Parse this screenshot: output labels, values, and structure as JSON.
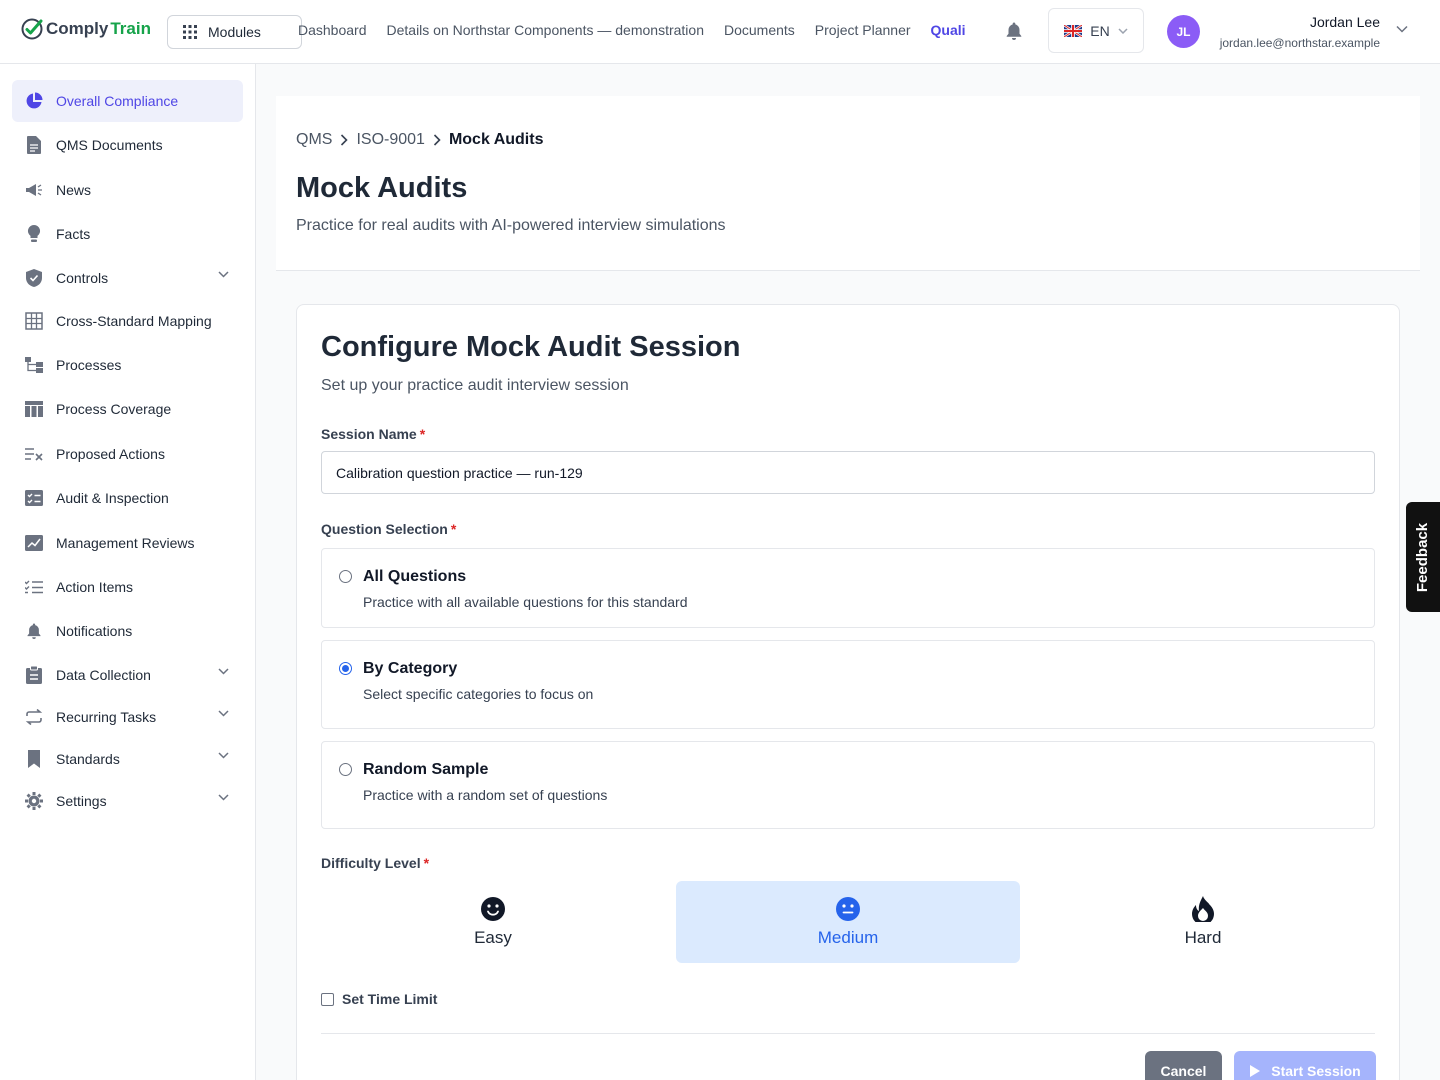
{
  "brand": {
    "comply": "Comply",
    "train": "Train"
  },
  "topbar": {
    "modules_label": "Modules",
    "nav": [
      "Dashboard",
      "Details on Northstar Components — demonstration",
      "Documents",
      "Project Planner",
      "Quali"
    ],
    "language": "EN",
    "user": {
      "initials": "JL",
      "name": "Jordan Lee",
      "email": "jordan.lee@northstar.example"
    }
  },
  "sidebar": {
    "items": [
      {
        "label": "Overall Compliance",
        "icon": "pie-chart-icon"
      },
      {
        "label": "QMS Documents",
        "icon": "document-icon"
      },
      {
        "label": "News",
        "icon": "megaphone-icon"
      },
      {
        "label": "Facts",
        "icon": "lightbulb-icon"
      },
      {
        "label": "Controls",
        "icon": "shield-icon"
      },
      {
        "label": "Cross-Standard Mapping",
        "icon": "grid-icon"
      },
      {
        "label": "Processes",
        "icon": "hierarchy-icon"
      },
      {
        "label": "Process Coverage",
        "icon": "table-icon"
      },
      {
        "label": "Proposed Actions",
        "icon": "list-x-icon"
      },
      {
        "label": "Audit & Inspection",
        "icon": "checklist-icon"
      },
      {
        "label": "Management Reviews",
        "icon": "chart-edit-icon"
      },
      {
        "label": "Action Items",
        "icon": "task-list-icon"
      },
      {
        "label": "Notifications",
        "icon": "bell-icon"
      },
      {
        "label": "Data Collection",
        "icon": "clipboard-icon"
      },
      {
        "label": "Recurring Tasks",
        "icon": "repeat-icon"
      },
      {
        "label": "Standards",
        "icon": "bookmark-icon"
      },
      {
        "label": "Settings",
        "icon": "gear-icon"
      }
    ]
  },
  "header": {
    "breadcrumb": [
      "QMS",
      "ISO-9001",
      "Mock Audits"
    ],
    "title": "Mock Audits",
    "subtitle": "Practice for real audits with AI-powered interview simulations"
  },
  "form": {
    "title": "Configure Mock Audit Session",
    "subtitle": "Set up your practice audit interview session",
    "session_name_label": "Session Name",
    "session_name_value": "Calibration question practice — run-129",
    "question_selection_label": "Question Selection",
    "options": [
      {
        "title": "All Questions",
        "desc": "Practice with all available questions for this standard",
        "selected": false
      },
      {
        "title": "By Category",
        "desc": "Select specific categories to focus on",
        "selected": true
      },
      {
        "title": "Random Sample",
        "desc": "Practice with a random set of questions",
        "selected": false
      }
    ],
    "difficulty_label": "Difficulty Level",
    "difficulty": [
      {
        "label": "Easy",
        "icon": "smile-icon",
        "selected": false
      },
      {
        "label": "Medium",
        "icon": "neutral-face-icon",
        "selected": true
      },
      {
        "label": "Hard",
        "icon": "flame-icon",
        "selected": false
      }
    ],
    "time_limit_label": "Set Time Limit",
    "time_limit_checked": false,
    "cancel_label": "Cancel",
    "start_label": "Start Session"
  },
  "feedback_label": "Feedback",
  "colors": {
    "accent": "#4f46e5",
    "selected_bg": "#dbeafe",
    "selected_text": "#2563eb",
    "brand_green": "#16a34a"
  }
}
